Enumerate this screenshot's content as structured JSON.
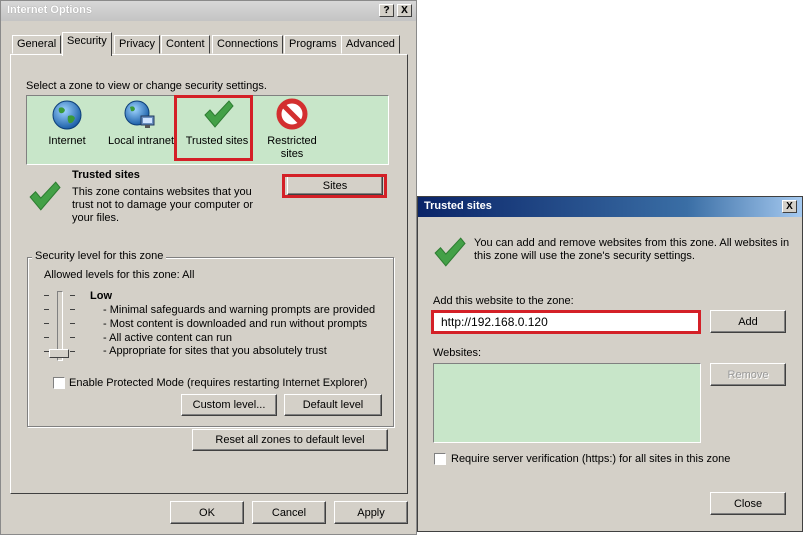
{
  "internet_options": {
    "title": "Internet Options",
    "help_button": "?",
    "close_button": "X",
    "tabs": [
      {
        "label": "General"
      },
      {
        "label": "Security"
      },
      {
        "label": "Privacy"
      },
      {
        "label": "Content"
      },
      {
        "label": "Connections"
      },
      {
        "label": "Programs"
      },
      {
        "label": "Advanced"
      }
    ],
    "zone_prompt": "Select a zone to view or change security settings.",
    "zones": [
      {
        "label": "Internet",
        "icon": "globe-icon"
      },
      {
        "label": "Local intranet",
        "icon": "globe-network-icon"
      },
      {
        "label": "Trusted sites",
        "icon": "checkmark-icon"
      },
      {
        "label": "Restricted sites",
        "icon": "no-entry-icon"
      }
    ],
    "zone_title": "Trusted sites",
    "zone_description": "This zone contains websites that you trust not to damage your computer or your files.",
    "sites_button": "Sites",
    "security_level_legend": "Security level for this zone",
    "allowed_levels": "Allowed levels for this zone: All",
    "level_name": "Low",
    "level_details": [
      "- Minimal safeguards and warning prompts are provided",
      "- Most content is downloaded and run without prompts",
      "- All active content can run",
      "- Appropriate for sites that you absolutely trust"
    ],
    "protected_mode_label": "Enable Protected Mode (requires restarting Internet Explorer)",
    "protected_mode_checked": false,
    "custom_level_button": "Custom level...",
    "default_level_button": "Default level",
    "reset_all_button": "Reset all zones to default level",
    "ok_button": "OK",
    "cancel_button": "Cancel",
    "apply_button": "Apply"
  },
  "trusted_sites": {
    "title": "Trusted sites",
    "close_button": "X",
    "info_text": "You can add and remove websites from this zone. All websites in this zone will use the zone's security settings.",
    "add_label": "Add this website to the zone:",
    "url_value": "http://192.168.0.120",
    "add_button": "Add",
    "websites_label": "Websites:",
    "remove_button": "Remove",
    "require_verification_label": "Require server verification (https:) for all sites in this zone",
    "require_verification_checked": false,
    "close_dialog_button": "Close"
  },
  "colors": {
    "zone_background": "#c8e6c9",
    "highlight_red": "#d42027",
    "dialog_face": "#d4d0c8"
  }
}
